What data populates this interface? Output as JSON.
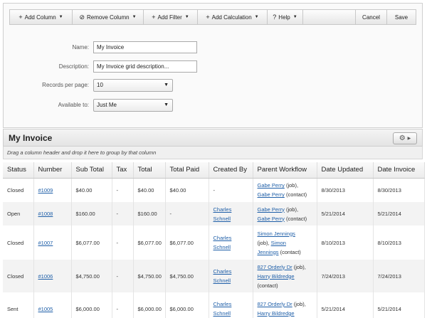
{
  "toolbar": {
    "add_column": "Add Column",
    "remove_column": "Remove Column",
    "add_filter": "Add Filter",
    "add_calculation": "Add Calculation",
    "help": "Help",
    "cancel": "Cancel",
    "save": "Save"
  },
  "form": {
    "name_label": "Name:",
    "name_value": "My Invoice",
    "description_label": "Description:",
    "description_value": "My Invoice grid description...",
    "records_label": "Records per page:",
    "records_value": "10",
    "available_label": "Available to:",
    "available_value": "Just Me"
  },
  "section": {
    "title": "My Invoice",
    "group_hint": "Drag a column header and drop it here to group by that column"
  },
  "table": {
    "columns": [
      "Status",
      "Number",
      "Sub Total",
      "Tax",
      "Total",
      "Total Paid",
      "Created By",
      "Parent Workflow",
      "Date Updated",
      "Date Invoice"
    ],
    "rows": [
      {
        "status": "Closed",
        "number": "#1009",
        "subtotal": "$40.00",
        "tax": "-",
        "total": "$40.00",
        "paid": "$40.00",
        "created": "-",
        "date_updated": "8/30/2013",
        "date_invoice": "8/30/2013"
      },
      {
        "status": "Open",
        "number": "#1008",
        "subtotal": "$160.00",
        "tax": "-",
        "total": "$160.00",
        "paid": "-",
        "created": "Charles Schnell",
        "date_updated": "5/21/2014",
        "date_invoice": "5/21/2014"
      },
      {
        "status": "Closed",
        "number": "#1007",
        "subtotal": "$6,077.00",
        "tax": "-",
        "total": "$6,077.00",
        "paid": "$6,077.00",
        "created": "Charles Schnell",
        "date_updated": "8/10/2013",
        "date_invoice": "8/10/2013"
      },
      {
        "status": "Closed",
        "number": "#1006",
        "subtotal": "$4,750.00",
        "tax": "-",
        "total": "$4,750.00",
        "paid": "$4,750.00",
        "created": "Charles Schnell",
        "date_updated": "7/24/2013",
        "date_invoice": "7/24/2013"
      },
      {
        "status": "Sent",
        "number": "#1005",
        "subtotal": "$6,000.00",
        "tax": "-",
        "total": "$6,000.00",
        "paid": "$6,000.00",
        "created": "Charles Schnell",
        "date_updated": "5/21/2014",
        "date_invoice": "5/21/2014"
      }
    ],
    "workflow": {
      "r1_link1": "Gabe Perry",
      "r1_text1": " (job),",
      "r1_link2": "Gabe Perry",
      "r1_text2": " (contact)",
      "r2_link1": "Gabe Perry",
      "r2_text1": " (job),",
      "r2_link2": "Gabe Perry",
      "r2_text2": " (contact)",
      "r3_link1": "Simon Jennings",
      "r3_text1": "(job), ",
      "r3_link2": "Simon",
      "r3_link3": "Jennings",
      "r3_text2": " (contact)",
      "r4_link1": "827 Orderly Dr",
      "r4_text1": " (job),",
      "r4_link2": "Harry Bildredge",
      "r4_text2": "(contact)",
      "r5_link1": "827 Orderly Dr",
      "r5_text1": " (job),",
      "r5_link2": "Harry Bildredge"
    }
  }
}
